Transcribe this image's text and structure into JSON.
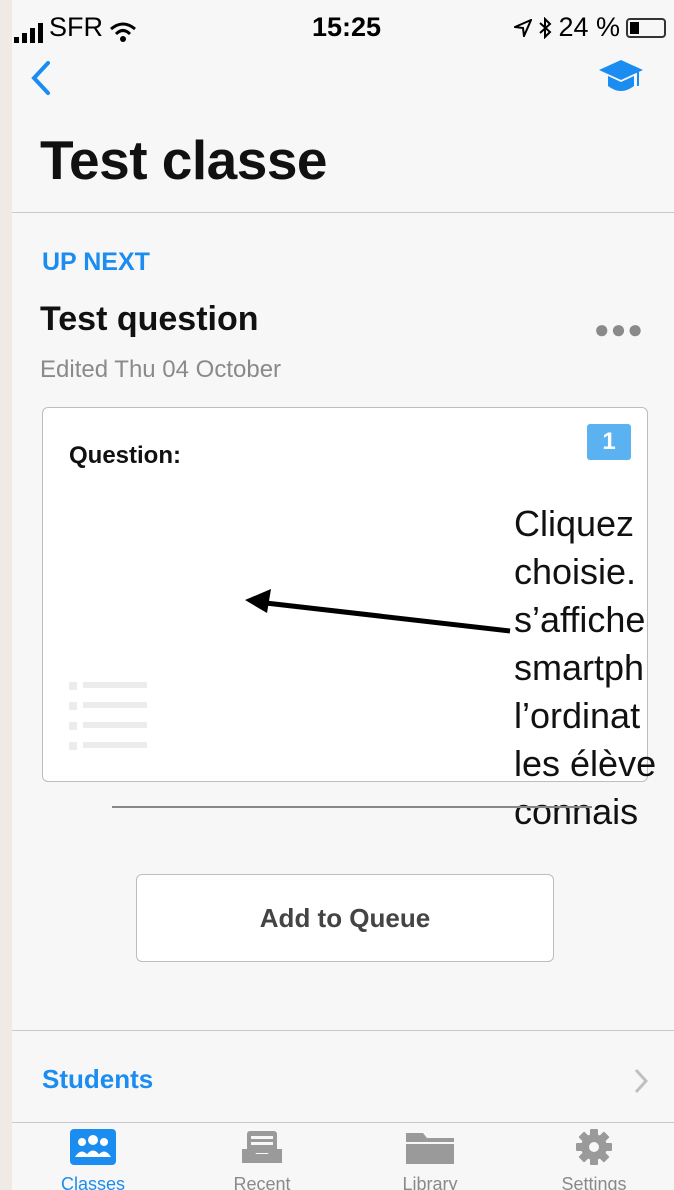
{
  "status_bar": {
    "carrier": "SFR",
    "time": "15:25",
    "battery": "24 %",
    "battery_level": 0.24
  },
  "nav": {
    "title": "Test classe"
  },
  "up_next": {
    "heading": "UP NEXT",
    "question_title": "Test question",
    "edited": "Edited Thu 04 October",
    "card_label": "Question:",
    "badge": "1"
  },
  "annotation": "Cliquez\nchoisie.\ns’affiche\nsmartph\nl’ordinat\nles élève\nconnais",
  "add_button": "Add to Queue",
  "students": {
    "label": "Students"
  },
  "tabs": [
    {
      "label": "Classes",
      "icon": "people-icon"
    },
    {
      "label": "Recent",
      "icon": "inbox-tray-icon"
    },
    {
      "label": "Library",
      "icon": "folder-icon"
    },
    {
      "label": "Settings",
      "icon": "gear-icon"
    }
  ],
  "colors": {
    "accent": "#1b8cf0",
    "badge": "#5ab3f0"
  }
}
